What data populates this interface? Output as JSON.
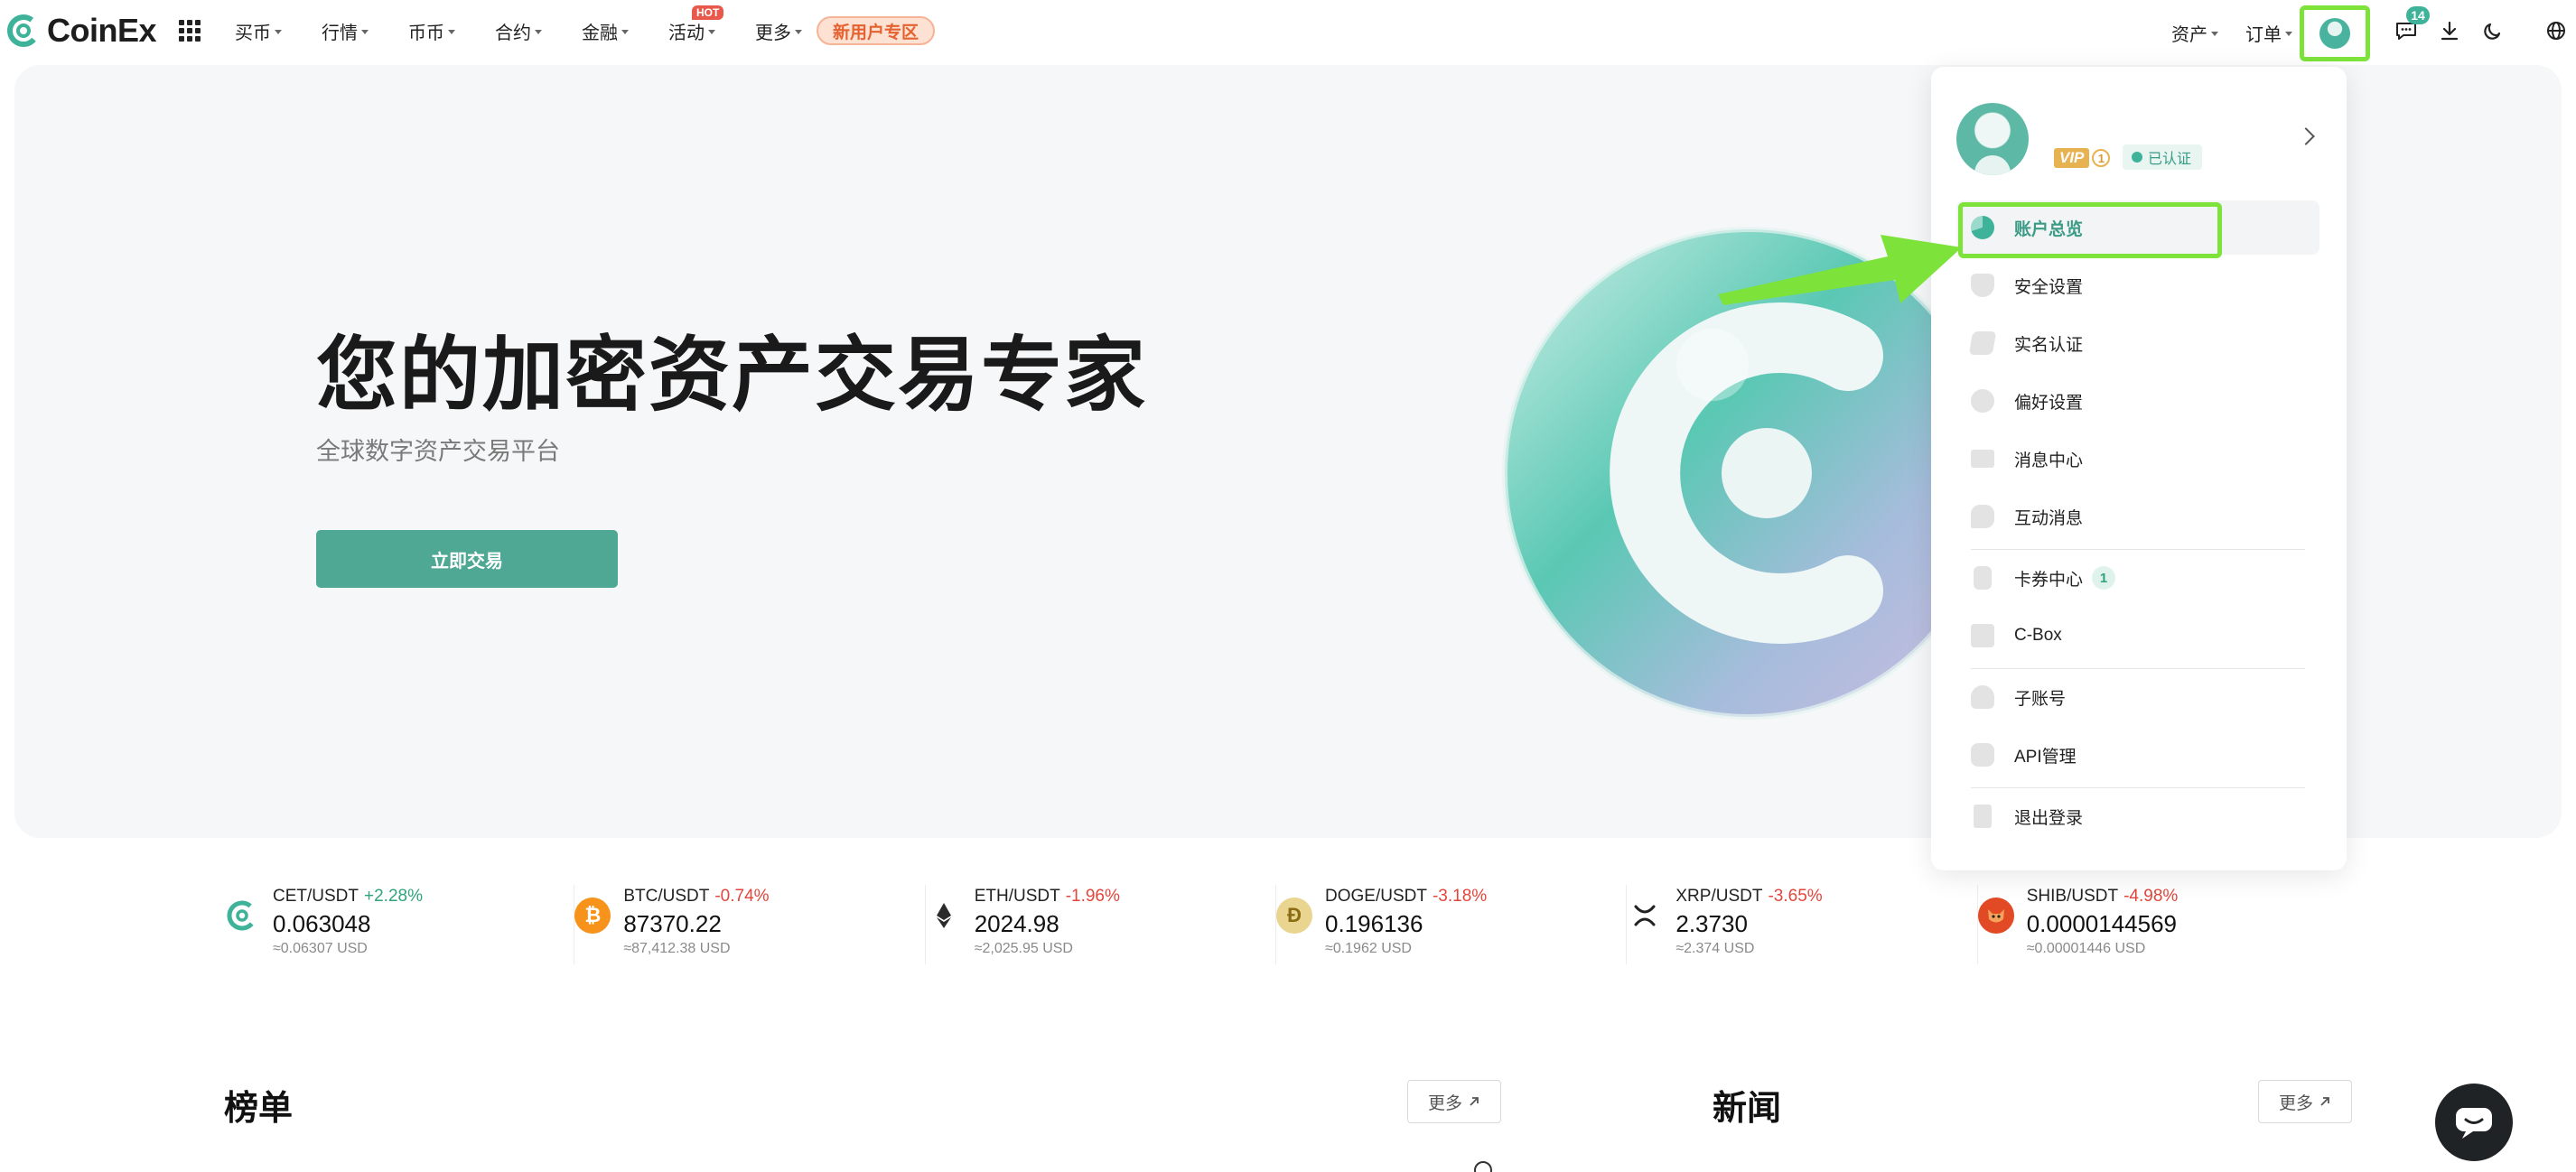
{
  "brand": {
    "name": "CoinEx",
    "accent": "#4fa894",
    "highlight": "#7de33a"
  },
  "nav": {
    "items": [
      {
        "label": "买币"
      },
      {
        "label": "行情"
      },
      {
        "label": "币币"
      },
      {
        "label": "合约"
      },
      {
        "label": "金融"
      },
      {
        "label": "活动",
        "badge": "HOT"
      },
      {
        "label": "更多"
      }
    ],
    "promo": "新用户专区",
    "right": {
      "assets": "资产",
      "orders": "订单",
      "notifications_count": "14"
    }
  },
  "hero": {
    "title": "您的加密资产交易专家",
    "subtitle": "全球数字资产交易平台",
    "cta": "立即交易"
  },
  "tickers": [
    {
      "pair": "CET/USDT",
      "change": "+2.28%",
      "direction": "up",
      "price": "0.063048",
      "usd": "≈0.06307 USD",
      "icon": "cet-coin-icon",
      "color": "#3fb39a"
    },
    {
      "pair": "BTC/USDT",
      "change": "-0.74%",
      "direction": "down",
      "price": "87370.22",
      "usd": "≈87,412.38 USD",
      "icon": "btc-coin-icon",
      "color": "#f7931a"
    },
    {
      "pair": "ETH/USDT",
      "change": "-1.96%",
      "direction": "down",
      "price": "2024.98",
      "usd": "≈2,025.95 USD",
      "icon": "eth-coin-icon",
      "color": "#2b2b2b"
    },
    {
      "pair": "DOGE/USDT",
      "change": "-3.18%",
      "direction": "down",
      "price": "0.196136",
      "usd": "≈0.1962 USD",
      "icon": "doge-coin-icon",
      "color": "#c9a93a"
    },
    {
      "pair": "XRP/USDT",
      "change": "-3.65%",
      "direction": "down",
      "price": "2.3730",
      "usd": "≈2.374 USD",
      "icon": "xrp-coin-icon",
      "color": "#222222"
    },
    {
      "pair": "SHIB/USDT",
      "change": "-4.98%",
      "direction": "down",
      "price": "0.0000144569",
      "usd": "≈0.00001446 USD",
      "icon": "shib-coin-icon",
      "color": "#e24a26"
    }
  ],
  "sections": {
    "ranking": {
      "title": "榜单",
      "more": "更多"
    },
    "news": {
      "title": "新闻",
      "more": "更多"
    }
  },
  "user_menu": {
    "vip_label": "VIP",
    "vip_level": "1",
    "verified": "已认证",
    "items": [
      {
        "label": "账户总览",
        "icon": "pie-chart-icon",
        "active": true
      },
      {
        "label": "安全设置",
        "icon": "shield-icon"
      },
      {
        "label": "实名认证",
        "icon": "id-card-icon"
      },
      {
        "label": "偏好设置",
        "icon": "settings-icon"
      },
      {
        "label": "消息中心",
        "icon": "message-icon"
      },
      {
        "label": "互动消息",
        "icon": "chat-bubbles-icon"
      },
      {
        "label": "卡券中心",
        "icon": "coupon-icon",
        "badge": "1"
      },
      {
        "label": "C-Box",
        "icon": "box-icon"
      },
      {
        "label": "子账号",
        "icon": "sub-account-icon"
      },
      {
        "label": "API管理",
        "icon": "api-icon"
      },
      {
        "label": "退出登录",
        "icon": "logout-icon"
      }
    ]
  }
}
